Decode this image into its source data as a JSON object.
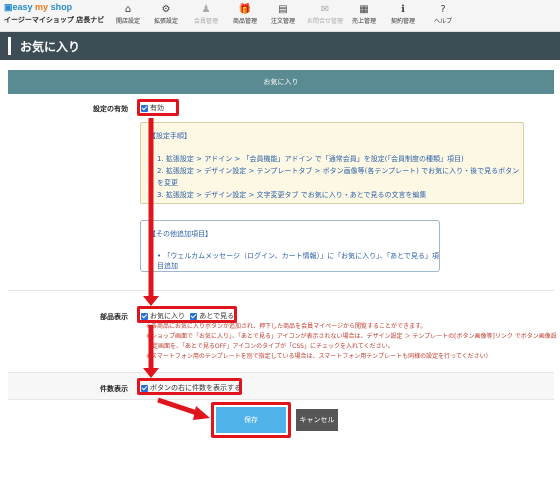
{
  "header": {
    "logo_brand": "easy my shop",
    "logo_easy": "easy",
    "logo_my": " my ",
    "logo_shop": "shop",
    "logo_sub": "イージーマイショップ 店長ナビ",
    "nav": [
      {
        "label": "開店設定",
        "icon": "home-icon",
        "glyph": "⌂"
      },
      {
        "label": "拡張設定",
        "icon": "gear-icon",
        "glyph": "⚙"
      },
      {
        "label": "会員管理",
        "icon": "user-icon",
        "glyph": "♟"
      },
      {
        "label": "商品管理",
        "icon": "gift-icon",
        "glyph": "🎁"
      },
      {
        "label": "注文管理",
        "icon": "document-icon",
        "glyph": "▤"
      },
      {
        "label": "お問合せ管理",
        "icon": "mail-icon",
        "glyph": "✉"
      },
      {
        "label": "売上管理",
        "icon": "calculator-icon",
        "glyph": "▦"
      },
      {
        "label": "契約管理",
        "icon": "info-icon",
        "glyph": "ℹ"
      },
      {
        "label": "ヘルプ",
        "icon": "help-icon",
        "glyph": "?"
      }
    ]
  },
  "page": {
    "title": "お気に入り",
    "section_header": "お気に入り"
  },
  "settings": {
    "enable_label": "設定の有効",
    "enable_checkbox_label": "有効",
    "guide_title": "【設定手順】",
    "guide_steps": [
      "1. 拡張設定 > アドイン > 「会員機能」アドイン で「通常会員」を設定(「会員制度の種類」項目)",
      "2. 拡張設定 > デザイン設定 > テンプレートタブ > ボタン画像等(各テンプレート) でお気に入り・後で見るボタンを変更",
      "3. 拡張設定 > デザイン設定 > 文字変更タブ でお気に入り・あとで見るの文言を編集"
    ],
    "other_title": "【その他追加項目】",
    "other_items": [
      "「ウェルカムメッセージ（ログイン、カート情報）」に「お気に入り」、「あとで見る」項目追加"
    ],
    "parts_label": "部品表示",
    "parts_options": [
      "お気に入り",
      "あとで見る"
    ],
    "parts_notes": [
      "※各商品にお気に入りボタンが追加され、押下した商品を会員マイページから閲覧することができます。",
      "※ショップ画面で「お気に入り」、「あとで見る」アイコンが表示されない場合は、デザイン設定 ＞ テンプレートの[ボタン画像等]リンク でボタン画像設",
      "　定画面を、「あとで見るOFF」アイコンのタイプが「CSS」にチェックを入れてください。",
      "※スマートフォン用のテンプレートを別で指定している場合は、スマートフォン用テンプレートも同様の設定を行ってください）"
    ],
    "count_label": "件数表示",
    "count_checkbox_label": "ボタンの右に件数を表示する"
  },
  "actions": {
    "save_label": "保存",
    "cancel_label": "キャンセル"
  },
  "colors": {
    "header_bar": "#3c4d56",
    "section_header": "#5a8a92",
    "highlight": "#e0141c",
    "save_button": "#4fb3ea",
    "cancel_button": "#555555"
  }
}
